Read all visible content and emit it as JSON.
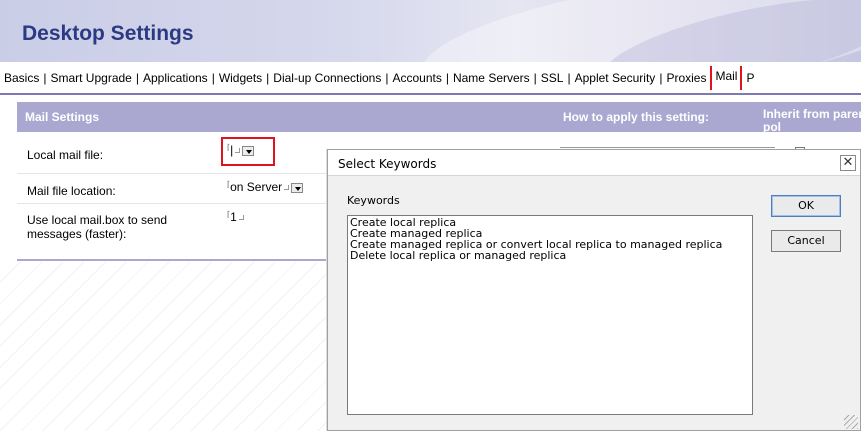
{
  "banner": {
    "title": "Desktop Settings"
  },
  "tabs": [
    {
      "label": "Basics"
    },
    {
      "label": "Smart Upgrade"
    },
    {
      "label": "Applications"
    },
    {
      "label": "Widgets"
    },
    {
      "label": "Dial-up Connections"
    },
    {
      "label": "Accounts"
    },
    {
      "label": "Name Servers"
    },
    {
      "label": "SSL"
    },
    {
      "label": "Applet Security"
    },
    {
      "label": "Proxies"
    },
    {
      "label": "Mail",
      "active": true
    },
    {
      "label": "P"
    }
  ],
  "settings": {
    "header_title": "Mail Settings",
    "header_apply": "How to apply this setting:",
    "header_inherit": "Inherit from parent pol",
    "rows": [
      {
        "label": "Local mail file:",
        "value": "",
        "has_dropdown": true
      },
      {
        "label": "Mail file location:",
        "value": "on Server",
        "has_dropdown": true
      },
      {
        "label": "Use local mail.box to send messages (faster):",
        "value": "1",
        "has_dropdown": false
      }
    ]
  },
  "dialog": {
    "title": "Select Keywords",
    "close_glyph": "✕",
    "keywords_label": "Keywords",
    "items": [
      "Create local replica",
      "Create managed replica",
      "Create managed replica or convert local replica to managed replica",
      "Delete local replica or managed replica"
    ],
    "ok_label": "OK",
    "cancel_label": "Cancel"
  },
  "colors": {
    "accent": "#2b3a82",
    "header_bg": "#aaa8d1",
    "highlight": "#e0121c"
  }
}
